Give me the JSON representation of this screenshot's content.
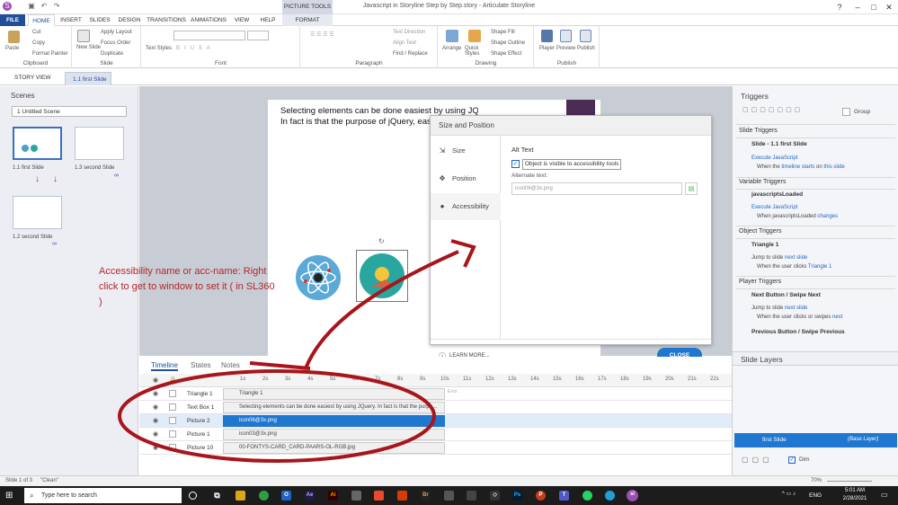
{
  "window": {
    "title": "Javascript in Storyline Step by Step.story - Articulate Storyline",
    "picture_tools": "PICTURE TOOLS"
  },
  "tabs": [
    "FILE",
    "HOME",
    "INSERT",
    "SLIDES",
    "DESIGN",
    "TRANSITIONS",
    "ANIMATIONS",
    "VIEW",
    "HELP",
    "FORMAT"
  ],
  "ribbon": {
    "clipboard": {
      "label": "Clipboard",
      "paste": "Paste",
      "cut": "Cut",
      "copy": "Copy",
      "format_painter": "Format Painter"
    },
    "slide": {
      "label": "Slide",
      "new_slide": "New Slide",
      "apply_layout": "Apply Layout",
      "focus_order": "Focus Order",
      "duplicate": "Duplicate"
    },
    "font": {
      "label": "Font",
      "text_styles": "Text Styles"
    },
    "paragraph": {
      "label": "Paragraph",
      "text_direction": "Text Direction",
      "align_text": "Align Text",
      "find_replace": "Find / Replace"
    },
    "drawing": {
      "label": "Drawing",
      "arrange": "Arrange",
      "quick_styles": "Quick Styles",
      "shape_fill": "Shape Fill",
      "shape_outline": "Shape Outline",
      "shape_effect": "Shape Effect"
    },
    "publish": {
      "label": "Publish",
      "player": "Player",
      "preview": "Preview",
      "publish": "Publish"
    }
  },
  "view_tabs": {
    "story_view": "STORY VIEW",
    "slide_tab": "1.1 first Slide"
  },
  "scenes": {
    "title": "Scenes",
    "selected_scene": "1 Untitled Scene",
    "thumbs": [
      "1.1 first Slide",
      "1.3 second Slide",
      "1.2 second Slide"
    ]
  },
  "slide": {
    "text_line1": "Selecting elements can be done easiest by using JQuery.",
    "text_line2": "In fact is that the purpose of jQuery, easy s"
  },
  "dialog": {
    "title": "Size and Position",
    "nav": [
      "Size",
      "Position",
      "Accessibility"
    ],
    "section": "Alt Text",
    "visible_checkbox": "Object is visible to accessibility tools",
    "alt_label": "Alternate text:",
    "alt_value": "icon06@3x.png",
    "learn_more": "LEARN MORE...",
    "close": "CLOSE"
  },
  "annotation": {
    "text": "Accessibility name or acc-name: Right click to get to window to set it ( in SL360 )",
    "color": "#b3282d"
  },
  "timeline": {
    "tabs": [
      "Timeline",
      "States",
      "Notes"
    ],
    "ticks": [
      "1s",
      "2s",
      "3s",
      "4s",
      "5s",
      "6s",
      "7s",
      "8s",
      "9s",
      "10s",
      "11s",
      "12s",
      "13s",
      "14s",
      "15s",
      "16s",
      "17s",
      "18s",
      "19s",
      "20s",
      "21s",
      "22s"
    ],
    "end": "End",
    "rows": [
      {
        "name": "Triangle 1",
        "bar": "Triangle 1"
      },
      {
        "name": "Text Box 1",
        "bar": "Selecting elements can be done easiest by using JQuery. In fact is that the purpo..."
      },
      {
        "name": "Picture 2",
        "bar": "icon06@3x.png"
      },
      {
        "name": "Picture 1",
        "bar": "icon03@3x.png"
      },
      {
        "name": "Picture 10",
        "bar": "00-FONTYS-CARD_CARD-PAARS-OL-RGB.jpg"
      }
    ]
  },
  "triggers": {
    "title": "Triggers",
    "group": "Group",
    "slide_triggers": "Slide Triggers",
    "slide_name": "Slide - 1.1 first Slide",
    "exec_js": "Execute JavaScript",
    "when1": "When the",
    "when1_link": "timeline starts",
    "when1_on": "on",
    "when1_this": "this slide",
    "variable_triggers": "Variable Triggers",
    "var_name": "javascriptsLoaded",
    "when2": "When javascriptsLoaded",
    "when2_link": "changes",
    "object_triggers": "Object Triggers",
    "obj_name": "Triangle 1",
    "jump": "Jump to slide",
    "jump_link": "next slide",
    "when3": "When the user clicks",
    "when3_link": "Triangle 1",
    "player_triggers": "Player Triggers",
    "next_btn": "Next Button / Swipe Next",
    "when4": "When the user clicks or swipes",
    "when4_link": "next",
    "prev_btn": "Previous Button / Swipe Previous",
    "slide_layers": "Slide Layers",
    "layer_name": "first Slide",
    "layer_base": "(Base Layer)",
    "dim": "Dim"
  },
  "statusbar": {
    "slide": "Slide 1 of 3",
    "clean": "\"Clean\"",
    "zoom": "70%"
  },
  "taskbar": {
    "search": "Type here to search",
    "lang": "ENG",
    "time": "5:01 AM",
    "date": "2/28/2021"
  }
}
